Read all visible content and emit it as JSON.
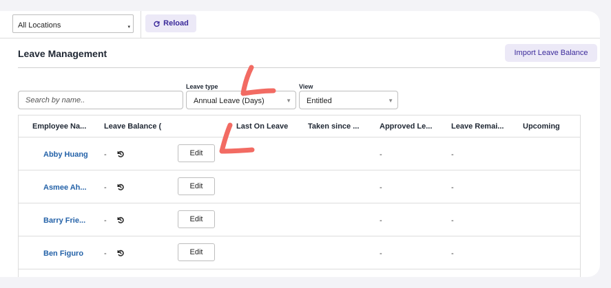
{
  "topbar": {
    "location_select": "All Locations",
    "reload_label": "Reload"
  },
  "section": {
    "title": "Leave Management",
    "import_label": "Import Leave Balance"
  },
  "filters": {
    "search_placeholder": "Search by name..",
    "leave_type_label": "Leave type",
    "leave_type_value": "Annual Leave (Days)",
    "view_label": "View",
    "view_value": "Entitled"
  },
  "table": {
    "headers": [
      "Employee Na...",
      "Leave Balance (",
      "Last On Leave",
      "Taken since ...",
      "Approved Le...",
      "Leave Remai...",
      "Upcoming"
    ],
    "edit_label": "Edit",
    "rows": [
      {
        "name": "Abby Huang",
        "balance": "-",
        "approved": "-",
        "remaining": "-"
      },
      {
        "name": "Asmee Ah...",
        "balance": "-",
        "approved": "-",
        "remaining": "-"
      },
      {
        "name": "Barry Frie...",
        "balance": "-",
        "approved": "-",
        "remaining": "-"
      },
      {
        "name": "Ben Figuro",
        "balance": "-",
        "approved": "-",
        "remaining": "-"
      }
    ]
  },
  "colors": {
    "accent": "#3b2a9a",
    "accent_bg": "#ece9f7",
    "link": "#2462a8",
    "annotation": "#f26b63"
  },
  "icons": {
    "reload": "refresh-icon",
    "history": "history-icon",
    "dropdown": "caret-down-icon"
  }
}
